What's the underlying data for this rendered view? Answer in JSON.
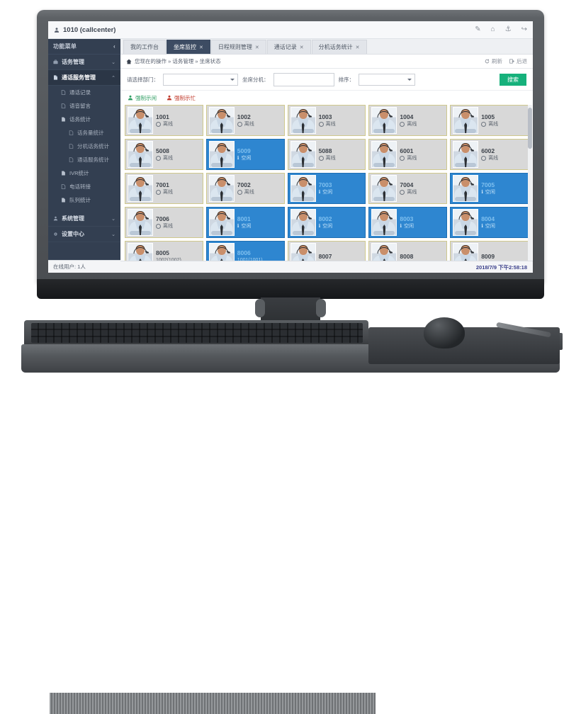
{
  "topbar": {
    "user": "1010 (callcenter)",
    "user_icon": "user-icon",
    "icons": [
      {
        "name": "edit-icon",
        "glyph": "✎"
      },
      {
        "name": "home-icon",
        "glyph": "⌂"
      },
      {
        "name": "org-tree-icon",
        "glyph": "⚓"
      },
      {
        "name": "logout-icon",
        "glyph": "↪"
      }
    ]
  },
  "sidebar": {
    "title": "功能菜单",
    "collapse_icon": "chevron-left-icon",
    "groups": [
      {
        "label": "话务管理",
        "icon": "briefcase-icon",
        "caret": "⌄",
        "active": false
      },
      {
        "label": "通话服务管理",
        "icon": "file-icon",
        "caret": "⌃",
        "active": true
      }
    ],
    "sub_items": [
      {
        "label": "通话记录",
        "level": 2,
        "icon": "doc-icon"
      },
      {
        "label": "语音留言",
        "level": 2,
        "icon": "doc-icon"
      },
      {
        "label": "话务统计",
        "level": 2,
        "icon": "doc-icon"
      },
      {
        "label": "话务量统计",
        "level": 3,
        "icon": "doc-icon"
      },
      {
        "label": "分机话务统计",
        "level": 3,
        "icon": "doc-icon"
      },
      {
        "label": "通话服务统计",
        "level": 3,
        "icon": "doc-icon"
      },
      {
        "label": "IVR统计",
        "level": 2,
        "icon": "doc-icon"
      },
      {
        "label": "电话转接",
        "level": 2,
        "icon": "doc-icon"
      },
      {
        "label": "队列统计",
        "level": 2,
        "icon": "doc-icon"
      }
    ],
    "groups_bottom": [
      {
        "label": "系统管理",
        "icon": "user-icon",
        "caret": "⌄"
      },
      {
        "label": "设置中心",
        "icon": "gear-icon",
        "caret": "⌄"
      }
    ],
    "footer": "在线用户: 1人"
  },
  "tabs": [
    {
      "label": "我的工作台",
      "closable": false,
      "active": false
    },
    {
      "label": "坐席监控",
      "closable": true,
      "active": true
    },
    {
      "label": "日程规则管理",
      "closable": true,
      "active": false
    },
    {
      "label": "通话记录",
      "closable": true,
      "active": false
    },
    {
      "label": "分机话务统计",
      "closable": true,
      "active": false
    }
  ],
  "breadcrumb": {
    "home_icon": "home-icon",
    "text": "您现在的操作 » 话务管理 » 坐席状态",
    "refresh_label": "刷新",
    "back_label": "后退"
  },
  "filters": {
    "dept_label": "请选择部门：",
    "dept_value": "",
    "ext_label": "坐席分机：",
    "ext_value": "",
    "sort_label": "排序：",
    "sort_value": "",
    "search_label": "搜索"
  },
  "actions": [
    {
      "label": "强制示闲",
      "kind": "free",
      "icon": "user-green-icon"
    },
    {
      "label": "强制示忙",
      "kind": "busy",
      "icon": "user-red-icon"
    }
  ],
  "status_labels": {
    "offline": "离线",
    "idle": "空闲"
  },
  "agents": [
    {
      "ext": "1001",
      "sub": "",
      "online": false,
      "status": "离线"
    },
    {
      "ext": "1002",
      "sub": "",
      "online": false,
      "status": "离线"
    },
    {
      "ext": "1003",
      "sub": "",
      "online": false,
      "status": "离线"
    },
    {
      "ext": "1004",
      "sub": "",
      "online": false,
      "status": "离线"
    },
    {
      "ext": "1005",
      "sub": "",
      "online": false,
      "status": "离线"
    },
    {
      "ext": "5008",
      "sub": "",
      "online": false,
      "status": "离线"
    },
    {
      "ext": "5009",
      "sub": "",
      "online": true,
      "status": "空闲"
    },
    {
      "ext": "5088",
      "sub": "",
      "online": false,
      "status": "离线"
    },
    {
      "ext": "6001",
      "sub": "",
      "online": false,
      "status": "离线"
    },
    {
      "ext": "6002",
      "sub": "",
      "online": false,
      "status": "离线"
    },
    {
      "ext": "7001",
      "sub": "",
      "online": false,
      "status": "离线"
    },
    {
      "ext": "7002",
      "sub": "",
      "online": false,
      "status": "离线"
    },
    {
      "ext": "7003",
      "sub": "",
      "online": true,
      "status": "空闲"
    },
    {
      "ext": "7004",
      "sub": "",
      "online": false,
      "status": "离线"
    },
    {
      "ext": "7005",
      "sub": "",
      "online": true,
      "status": "空闲"
    },
    {
      "ext": "7006",
      "sub": "",
      "online": false,
      "status": "离线"
    },
    {
      "ext": "8001",
      "sub": "",
      "online": true,
      "status": "空闲"
    },
    {
      "ext": "8002",
      "sub": "",
      "online": true,
      "status": "空闲"
    },
    {
      "ext": "8003",
      "sub": "",
      "online": true,
      "status": "空闲"
    },
    {
      "ext": "8004",
      "sub": "",
      "online": true,
      "status": "空闲"
    },
    {
      "ext": "8005",
      "sub": "1002(1002)",
      "online": false,
      "status": ""
    },
    {
      "ext": "8006",
      "sub": "1001(1001)",
      "online": true,
      "status": ""
    },
    {
      "ext": "8007",
      "sub": "",
      "online": false,
      "status": ""
    },
    {
      "ext": "8008",
      "sub": "",
      "online": false,
      "status": ""
    },
    {
      "ext": "8009",
      "sub": "",
      "online": false,
      "status": ""
    }
  ],
  "statusbar": {
    "clock": "2018/7/9 下午2:58:18"
  },
  "colors": {
    "sidebar_bg": "#333f51",
    "tab_active": "#3d4c63",
    "search_btn": "#16b17b",
    "card_online": "#2e86d0",
    "card_offline": "#d8d8d8",
    "card_border": "#cfc98d",
    "free_link": "#2f9e63",
    "busy_link": "#c0392b",
    "clock_text": "#3a3f8a"
  }
}
